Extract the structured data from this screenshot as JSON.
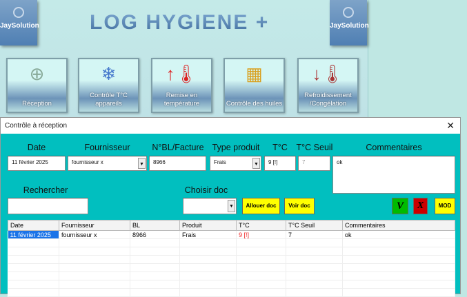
{
  "header": {
    "title": "LOG  HYGIENE +",
    "logo_text": "JaySolution"
  },
  "tiles": [
    {
      "label": "Réception",
      "icon": "box-plus-icon"
    },
    {
      "label": "Contrôle T°C appareils",
      "icon": "fridge-icon"
    },
    {
      "label": "Remise en température",
      "icon": "thermometer-up-icon"
    },
    {
      "label": "Contrôle des huiles",
      "icon": "fryer-icon"
    },
    {
      "label": "Refroidissement /Congélation",
      "icon": "thermometer-down-icon"
    }
  ],
  "dialog": {
    "title": "Contrôle à réception",
    "labels": {
      "date": "Date",
      "fournisseur": "Fournisseur",
      "bl": "N°BL/Facture",
      "type": "Type produit",
      "temp": "T°C",
      "seuil": "T°C Seuil",
      "comments": "Commentaires",
      "search": "Rechercher",
      "doc": "Choisir doc"
    },
    "values": {
      "date": "11 février 2025",
      "fournisseur": "fournisseur x",
      "bl": "8966",
      "type": "Frais",
      "temp": "9 [!]",
      "seuil": "7",
      "comments": "ok",
      "search": "",
      "doc": ""
    },
    "buttons": {
      "allouer": "Allouer doc",
      "voir": "Voir doc",
      "validate": "V",
      "cancel": "X",
      "mod": "MOD"
    },
    "table": {
      "columns": [
        "Date",
        "Fournisseur",
        "BL",
        "Produit",
        "T°C",
        "T°C Seuil",
        "Commentaires"
      ],
      "rows": [
        [
          "11 février 2025",
          "fournisseur x",
          "8966",
          "Frais",
          "9 [!]",
          "7",
          "ok"
        ]
      ]
    }
  }
}
